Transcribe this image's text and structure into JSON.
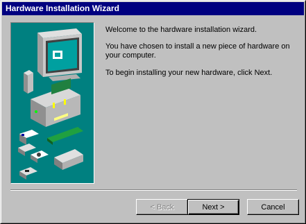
{
  "window": {
    "title": "Hardware Installation Wizard"
  },
  "content": {
    "welcome": "Welcome to the hardware installation wizard.",
    "chosen": "You have chosen to install a new piece of hardware on your computer.",
    "begin": "To begin installing your new hardware, click Next."
  },
  "buttons": {
    "back": "< Back",
    "next": "Next >",
    "cancel": "Cancel"
  },
  "illustration": {
    "background": "#008080",
    "name": "computer-hardware-illustration"
  }
}
